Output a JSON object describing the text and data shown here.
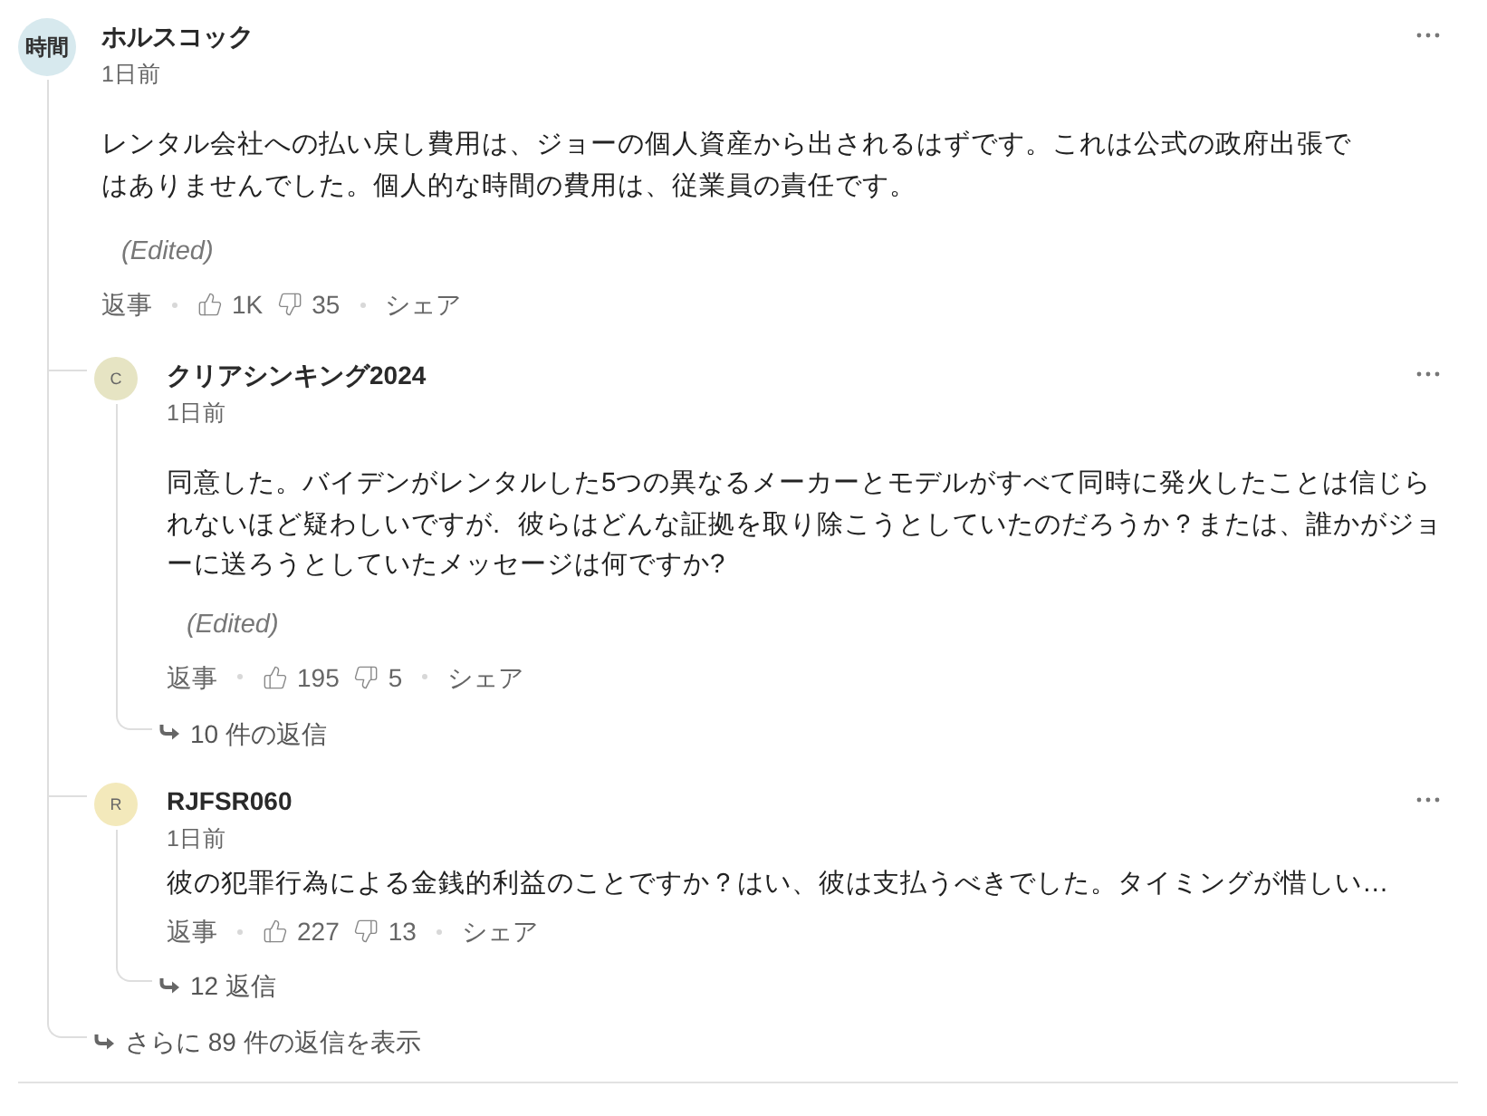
{
  "comment": {
    "avatar": {
      "text": "時間",
      "color": "#d7e9ee"
    },
    "author": "ホルスコック",
    "time": "1日前",
    "body": "レンタル会社への払い戻し費用は、ジョーの個人資産から出されるはずです。これは公式の政府出張ではありませんでした。個人的な時間の費用は、従業員の責任です。",
    "edited": "(Edited)",
    "actions": {
      "reply": "返事",
      "likes": "1K",
      "dislikes": "35",
      "share": "シェア"
    }
  },
  "replies": [
    {
      "avatar": {
        "text": "C",
        "color": "#e6e4c3"
      },
      "author": "クリアシンキング2024",
      "time": "1日前",
      "body": "同意した。バイデンがレンタルした5つの異なるメーカーとモデルがすべて同時に発火したことは信じられないほど疑わしいですが. 彼らはどんな証拠を取り除こうとしていたのだろうか？または、誰かがジョーに送ろうとしていたメッセージは何ですか?",
      "edited": "(Edited)",
      "actions": {
        "reply": "返事",
        "likes": "195",
        "dislikes": "5",
        "share": "シェア"
      },
      "reply_count": "10 件の返信"
    },
    {
      "avatar": {
        "text": "R",
        "color": "#f3e9bb"
      },
      "author": "RJFSR060",
      "time": "1日前",
      "body": "彼の犯罪行為による金銭的利益のことですか？はい、彼は支払うべきでした。タイミングが惜しい…",
      "actions": {
        "reply": "返事",
        "likes": "227",
        "dislikes": "13",
        "share": "シェア"
      },
      "reply_count": "12 返信"
    }
  ],
  "more_replies": "さらに 89 件の返信を表示"
}
